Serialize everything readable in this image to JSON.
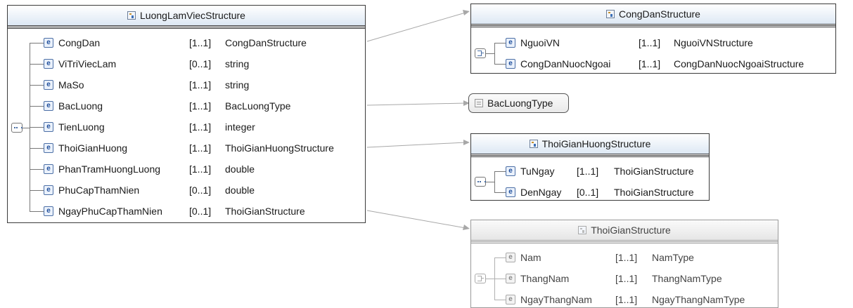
{
  "boxes": {
    "luong": {
      "title": "LuongLamViecStructure",
      "rows": [
        {
          "name": "CongDan",
          "card": "[1..1]",
          "type": "CongDanStructure"
        },
        {
          "name": "ViTriViecLam",
          "card": "[0..1]",
          "type": "string"
        },
        {
          "name": "MaSo",
          "card": "[1..1]",
          "type": "string"
        },
        {
          "name": "BacLuong",
          "card": "[1..1]",
          "type": "BacLuongType"
        },
        {
          "name": "TienLuong",
          "card": "[1..1]",
          "type": "integer"
        },
        {
          "name": "ThoiGianHuong",
          "card": "[1..1]",
          "type": "ThoiGianHuongStructure"
        },
        {
          "name": "PhanTramHuongLuong",
          "card": "[1..1]",
          "type": "double"
        },
        {
          "name": "PhuCapThamNien",
          "card": "[0..1]",
          "type": "double"
        },
        {
          "name": "NgayPhuCapThamNien",
          "card": "[0..1]",
          "type": "ThoiGianStructure"
        }
      ]
    },
    "congdan": {
      "title": "CongDanStructure",
      "rows": [
        {
          "name": "NguoiVN",
          "card": "[1..1]",
          "type": "NguoiVNStructure"
        },
        {
          "name": "CongDanNuocNgoai",
          "card": "[1..1]",
          "type": "CongDanNuocNgoaiStructure"
        }
      ]
    },
    "thoigianhuong": {
      "title": "ThoiGianHuongStructure",
      "rows": [
        {
          "name": "TuNgay",
          "card": "[1..1]",
          "type": "ThoiGianStructure"
        },
        {
          "name": "DenNgay",
          "card": "[0..1]",
          "type": "ThoiGianStructure"
        }
      ]
    },
    "thoigian": {
      "title": "ThoiGianStructure",
      "rows": [
        {
          "name": "Nam",
          "card": "[1..1]",
          "type": "NamType"
        },
        {
          "name": "ThangNam",
          "card": "[1..1]",
          "type": "ThangNamType"
        },
        {
          "name": "NgayThangNam",
          "card": "[1..1]",
          "type": "NgayThangNamType"
        }
      ]
    }
  },
  "simple_type": {
    "label": "BacLuongType"
  },
  "icons": {
    "element": "e",
    "structure": "structure-icon",
    "sequence": "sequence-compositor-icon",
    "choice": "choice-compositor-icon",
    "simple": "simple-type-icon"
  },
  "colors": {
    "header_gradient_end": "#dde8f4",
    "element_icon": "#1f4e9c",
    "border": "#3a3a3a",
    "inactive": "#9a9a9a"
  }
}
